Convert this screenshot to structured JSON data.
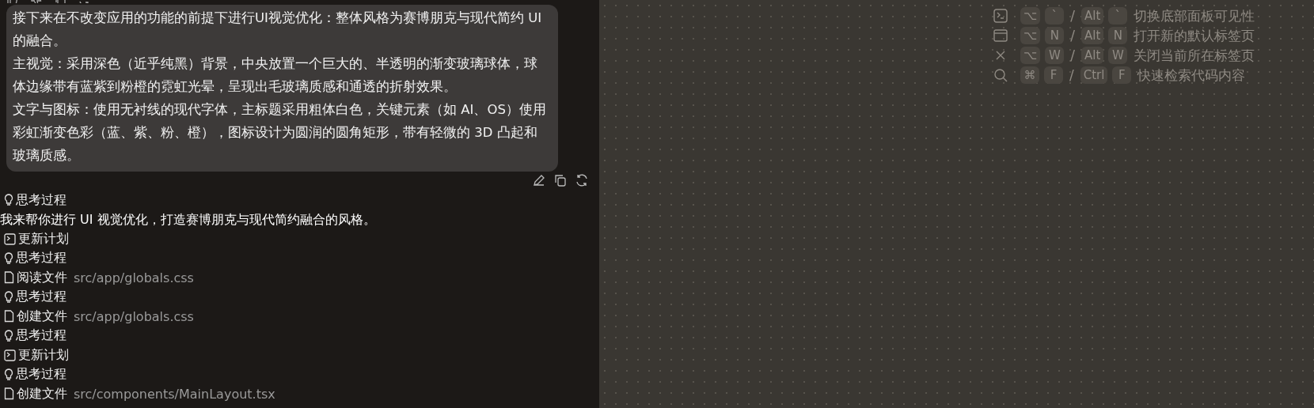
{
  "user_message": {
    "paragraphs": [
      "接下来在不改变应用的功能的前提下进行UI视觉优化：整体风格为赛博朋克与现代简约 UI 的融合。",
      "主视觉：采用深色（近乎纯黑）背景，中央放置一个巨大的、半透明的渐变玻璃球体，球体边缘带有蓝紫到粉橙的霓虹光晕，呈现出毛玻璃质感和通透的折射效果。",
      "文字与图标：使用无衬线的现代字体，主标题采用粗体白色，关键元素（如 AI、OS）使用彩虹渐变色彩（蓝、紫、粉、橙），图标设计为圆润的圆角矩形，带有轻微的 3D 凸起和玻璃质感。"
    ]
  },
  "steps": [
    {
      "kind": "thought",
      "label": "思考过程"
    },
    {
      "kind": "message",
      "label": "我来帮你进行 UI 视觉优化，打造赛博朋克与现代简约融合的风格。"
    },
    {
      "kind": "plan",
      "label": "更新计划"
    },
    {
      "kind": "thought",
      "label": "思考过程"
    },
    {
      "kind": "file",
      "label": "阅读文件",
      "path": "src/app/globals.css"
    },
    {
      "kind": "thought",
      "label": "思考过程"
    },
    {
      "kind": "file",
      "label": "创建文件",
      "path": "src/app/globals.css"
    },
    {
      "kind": "thought",
      "label": "思考过程"
    },
    {
      "kind": "plan",
      "label": "更新计划"
    },
    {
      "kind": "thought",
      "label": "思考过程"
    },
    {
      "kind": "file",
      "label": "创建文件",
      "path": "src/components/MainLayout.tsx"
    }
  ],
  "shortcuts": [
    {
      "kind": "terminal",
      "mac": [
        "⌥",
        "`"
      ],
      "win": [
        "Alt",
        "`"
      ],
      "sep": "/",
      "label": "切换底部面板可见性"
    },
    {
      "kind": "window",
      "mac": [
        "⌥",
        "N"
      ],
      "win": [
        "Alt",
        "N"
      ],
      "sep": "/",
      "label": "打开新的默认标签页"
    },
    {
      "kind": "close",
      "mac": [
        "⌥",
        "W"
      ],
      "win": [
        "Alt",
        "W"
      ],
      "sep": "/",
      "label": "关闭当前所在标签页"
    },
    {
      "kind": "search",
      "mac": [
        "⌘",
        "F"
      ],
      "win": [
        "Ctrl",
        "F"
      ],
      "sep": "/",
      "label": "快速检索代码内容"
    }
  ]
}
